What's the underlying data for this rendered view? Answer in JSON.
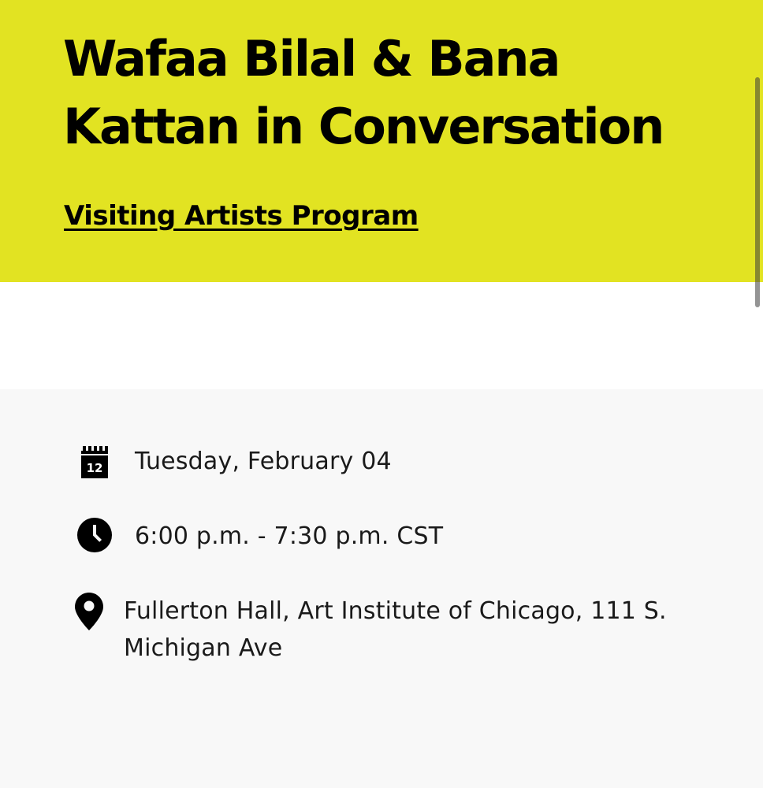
{
  "event": {
    "title": "Wafaa Bilal & Bana Kattan in Conversation",
    "program_link": "Visiting Artists Program"
  },
  "details": {
    "date_icon_day": "12",
    "date": "Tuesday, February 04",
    "time": "6:00 p.m. - 7:30 p.m. CST",
    "location": "Fullerton Hall, Art Institute of Chicago, 111 S. Michigan Ave"
  },
  "icons": {
    "date": "calendar-icon",
    "time": "clock-icon",
    "location": "map-pin-icon"
  },
  "colors": {
    "hero_background": "#e2e322",
    "details_background": "#f8f8f8",
    "text": "#000000"
  }
}
